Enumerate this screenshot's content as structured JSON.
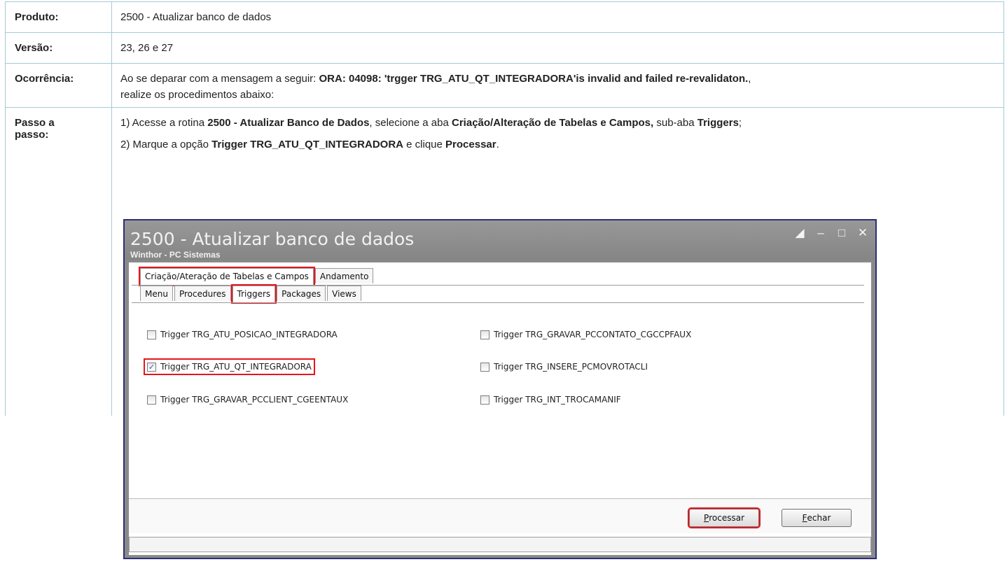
{
  "table": {
    "produto_label": "Produto:",
    "produto_value": "2500 - Atualizar banco de dados",
    "versao_label": "Versão:",
    "versao_value": "23, 26 e 27",
    "ocorrencia_label": "Ocorrência:",
    "ocorrencia_text1": "Ao se deparar com a mensagem a seguir: ",
    "ocorrencia_bold": "ORA: 04098: 'trgger TRG_ATU_QT_INTEGRADORA'is invalid and failed re-revalidaton.",
    "ocorrencia_text2": ",",
    "ocorrencia_text3": "realize os procedimentos abaixo:",
    "passo_label_1": "Passo a",
    "passo_label_2": "passo:",
    "step1": {
      "t1": "1) Acesse a rotina ",
      "b1": "2500  - Atualizar Banco de Dados",
      "t2": ", selecione a aba ",
      "b2": "Criação/Alteração de Tabelas e Campos,",
      "t3": " sub-aba ",
      "b3": "Triggers",
      "t4": ";"
    },
    "step2": {
      "t1": "2) Marque a opção ",
      "b1": "Trigger TRG_ATU_QT_INTEGRADORA",
      "t2": " e clique ",
      "b2": "Processar",
      "t3": "."
    }
  },
  "window": {
    "title": "2500 - Atualizar banco de dados",
    "subtitle": "Winthor - PC Sistemas",
    "main_tabs": [
      "Criação/Ateração de Tabelas e Campos",
      "Andamento"
    ],
    "sub_tabs": [
      "Menu",
      "Procedures",
      "Triggers",
      "Packages",
      "Views"
    ],
    "triggers": [
      {
        "label": "Trigger TRG_ATU_POSICAO_INTEGRADORA",
        "checked": false
      },
      {
        "label": "Trigger TRG_ATU_QT_INTEGRADORA",
        "checked": true
      },
      {
        "label": "Trigger TRG_GRAVAR_PCCLIENT_CGEENTAUX",
        "checked": false
      },
      {
        "label": "Trigger TRG_GRAVAR_PCCONTATO_CGCCPFAUX",
        "checked": false
      },
      {
        "label": "Trigger TRG_INSERE_PCMOVROTACLI",
        "checked": false
      },
      {
        "label": "Trigger TRG_INT_TROCAMANIF",
        "checked": false
      }
    ],
    "processar_first": "P",
    "processar_rest": "rocessar",
    "fechar_first": "F",
    "fechar_rest": "echar",
    "highlight_color": "#e8141c"
  }
}
